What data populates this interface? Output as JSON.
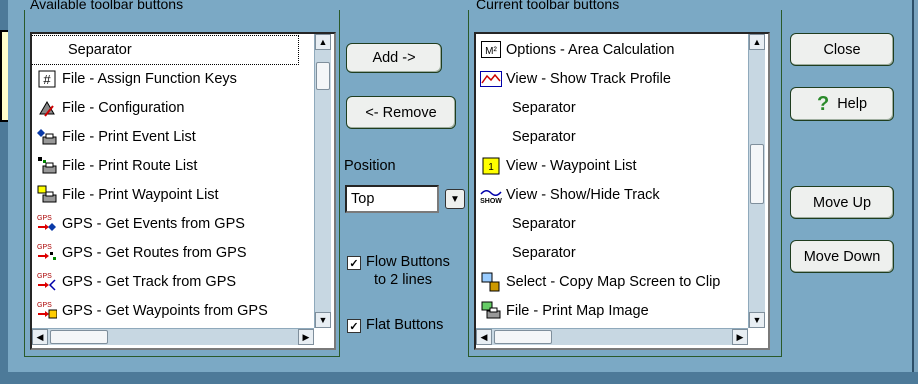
{
  "available": {
    "label": "Available toolbar buttons",
    "items": [
      {
        "label": "Separator",
        "icon": "none"
      },
      {
        "label": "File - Assign Function Keys",
        "icon": "hash-icon"
      },
      {
        "label": "File - Configuration",
        "icon": "configuration-icon"
      },
      {
        "label": "File - Print Event List",
        "icon": "print-event-icon"
      },
      {
        "label": "File - Print Route List",
        "icon": "print-route-icon"
      },
      {
        "label": "File - Print Waypoint List",
        "icon": "print-waypoint-icon"
      },
      {
        "label": "GPS - Get Events from GPS",
        "icon": "gps-events-icon"
      },
      {
        "label": "GPS - Get Routes from GPS",
        "icon": "gps-routes-icon"
      },
      {
        "label": "GPS - Get Track from GPS",
        "icon": "gps-track-icon"
      },
      {
        "label": "GPS - Get Waypoints from GPS",
        "icon": "gps-waypoints-icon"
      }
    ]
  },
  "current": {
    "label": "Current toolbar buttons",
    "items": [
      {
        "label": "Options - Area Calculation",
        "icon": "area-calc-icon"
      },
      {
        "label": "View - Show Track Profile",
        "icon": "track-profile-icon"
      },
      {
        "label": "Separator",
        "icon": "none"
      },
      {
        "label": "Separator",
        "icon": "none"
      },
      {
        "label": "View - Waypoint List",
        "icon": "waypoint-list-icon"
      },
      {
        "label": "View - Show/Hide Track",
        "icon": "show-track-icon"
      },
      {
        "label": "Separator",
        "icon": "none"
      },
      {
        "label": "Separator",
        "icon": "none"
      },
      {
        "label": "Select - Copy Map Screen to Clip",
        "icon": "copy-map-icon"
      },
      {
        "label": "File - Print Map Image",
        "icon": "print-map-icon"
      }
    ]
  },
  "buttons": {
    "add": "Add ->",
    "remove": "<- Remove",
    "close": "Close",
    "help": "Help",
    "move_up": "Move Up",
    "move_down": "Move Down"
  },
  "position": {
    "label": "Position",
    "value": "Top"
  },
  "options": {
    "flow_line1": "Flow Buttons",
    "flow_line2": "to 2 lines",
    "flow_checked": true,
    "flat": "Flat Buttons",
    "flat_checked": true
  },
  "colors": {
    "dialog_bg": "#7ba9c5",
    "button_face": "#eef0ee",
    "list_bg": "#ffffff"
  }
}
